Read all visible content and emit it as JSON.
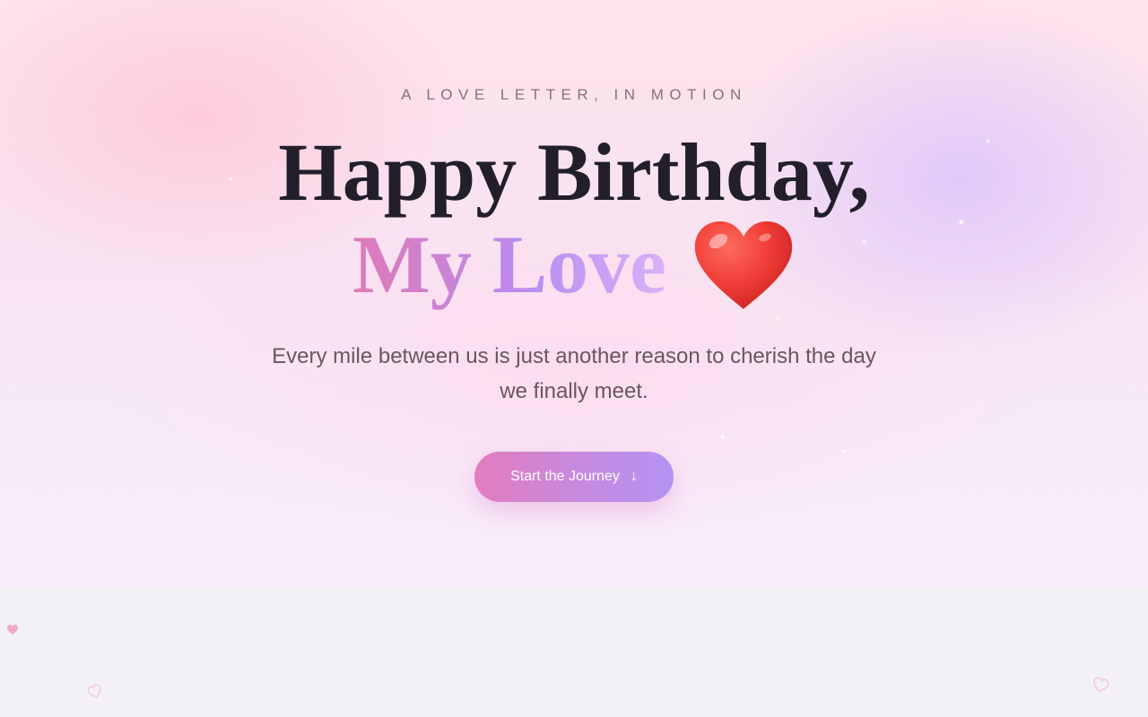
{
  "hero": {
    "eyebrow": "A LOVE LETTER, IN MOTION",
    "title_line_1": "Happy Birthday,",
    "title_line_2": "My Love",
    "title_emoji": "heart-icon",
    "subtitle": "Every mile between us is just another reason to cherish the day we finally meet.",
    "cta_label": "Start the Journey",
    "cta_icon": "arrow-down-icon"
  },
  "colors": {
    "title": "#221f2b",
    "love_gradient_start": "#e07ab6",
    "love_gradient_end": "#b98bf0",
    "cta_start": "#e37cbd",
    "cta_end": "#b394f3",
    "heart": "#ef3b36"
  },
  "decorations": {
    "floating_hearts": [
      "filled-heart-icon",
      "outline-heart-icon",
      "outline-heart-icon"
    ]
  }
}
